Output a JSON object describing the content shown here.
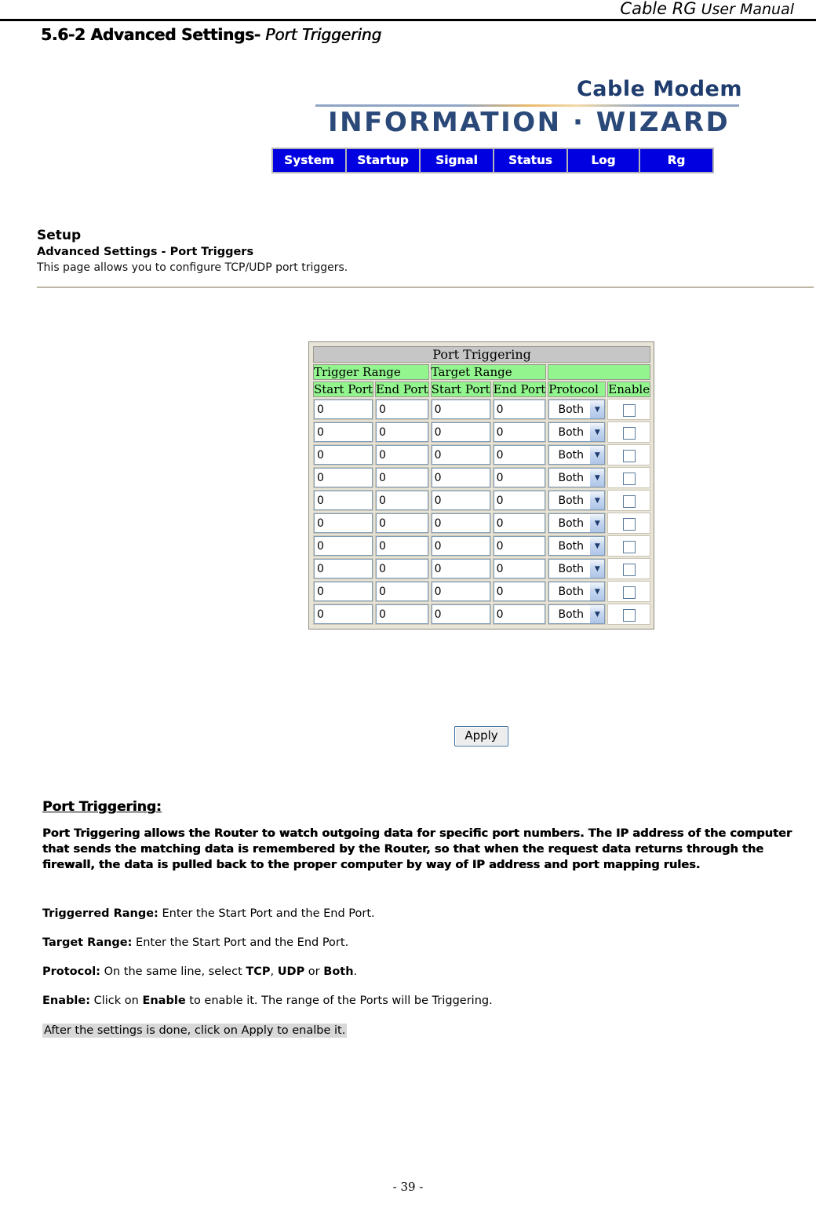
{
  "document": {
    "header_brand": "Cable RG",
    "header_suffix": " User Manual",
    "section_number": "5.6-2 Advanced Settings-",
    "section_name": " Port Triggering",
    "page_number": "- 39 -"
  },
  "webui": {
    "logo_top": "Cable Modem",
    "logo_main": "INFORMATION · WIZARD",
    "nav": [
      {
        "label": "System"
      },
      {
        "label": "Startup"
      },
      {
        "label": "Signal"
      },
      {
        "label": "Status"
      },
      {
        "label": "Log"
      },
      {
        "label": "Rg"
      }
    ],
    "setup": {
      "title": "Setup",
      "subtitle": "Advanced Settings - Port Triggers",
      "description": "This page allows you to configure TCP/UDP port triggers."
    },
    "table": {
      "caption": "Port Triggering",
      "group_headers": [
        "Trigger Range",
        "Target Range",
        ""
      ],
      "column_headers": [
        "Start Port",
        "End Port",
        "Start Port",
        "End Port",
        "Protocol",
        "Enable"
      ],
      "protocol_options": [
        "TCP",
        "UDP",
        "Both"
      ],
      "rows": [
        {
          "trigger_start": "0",
          "trigger_end": "0",
          "target_start": "0",
          "target_end": "0",
          "protocol": "Both",
          "enable": false
        },
        {
          "trigger_start": "0",
          "trigger_end": "0",
          "target_start": "0",
          "target_end": "0",
          "protocol": "Both",
          "enable": false
        },
        {
          "trigger_start": "0",
          "trigger_end": "0",
          "target_start": "0",
          "target_end": "0",
          "protocol": "Both",
          "enable": false
        },
        {
          "trigger_start": "0",
          "trigger_end": "0",
          "target_start": "0",
          "target_end": "0",
          "protocol": "Both",
          "enable": false
        },
        {
          "trigger_start": "0",
          "trigger_end": "0",
          "target_start": "0",
          "target_end": "0",
          "protocol": "Both",
          "enable": false
        },
        {
          "trigger_start": "0",
          "trigger_end": "0",
          "target_start": "0",
          "target_end": "0",
          "protocol": "Both",
          "enable": false
        },
        {
          "trigger_start": "0",
          "trigger_end": "0",
          "target_start": "0",
          "target_end": "0",
          "protocol": "Both",
          "enable": false
        },
        {
          "trigger_start": "0",
          "trigger_end": "0",
          "target_start": "0",
          "target_end": "0",
          "protocol": "Both",
          "enable": false
        },
        {
          "trigger_start": "0",
          "trigger_end": "0",
          "target_start": "0",
          "target_end": "0",
          "protocol": "Both",
          "enable": false
        },
        {
          "trigger_start": "0",
          "trigger_end": "0",
          "target_start": "0",
          "target_end": "0",
          "protocol": "Both",
          "enable": false
        }
      ]
    },
    "apply_label": "Apply"
  },
  "prose": {
    "heading": "Port Triggering:",
    "intro": "Port Triggering allows the Router to watch outgoing data for specific port numbers. The IP address of the computer that sends the matching data is remembered by the Router, so that when the request data returns through the firewall, the data is pulled back to the proper computer by way of IP address and port mapping rules.",
    "definitions": [
      {
        "term": "Triggerred Range:",
        "text": " Enter the Start Port and the End Port."
      },
      {
        "term": "Target Range:",
        "text": " Enter the Start Port and the End Port."
      },
      {
        "term": "Protocol:",
        "text": "   On the same line, select ",
        "bold_a": "TCP",
        "mid_a": ", ",
        "bold_b": "UDP",
        "mid_b": " or ",
        "bold_c": "Both",
        "tail": "."
      },
      {
        "term": "Enable:",
        "text": " Click on ",
        "bold_a": "Enable",
        "tail": " to enable it. The range of the Ports will be Triggering."
      }
    ],
    "note": "After the settings is done, click on Apply to enalbe it."
  },
  "colors": {
    "nav_tab_bg": "#0000E0",
    "table_header_green": "#92F58E",
    "table_caption_gray": "#C6C6C6",
    "logo_blue": "#2A4878",
    "note_highlight": "#D8D8D8"
  }
}
